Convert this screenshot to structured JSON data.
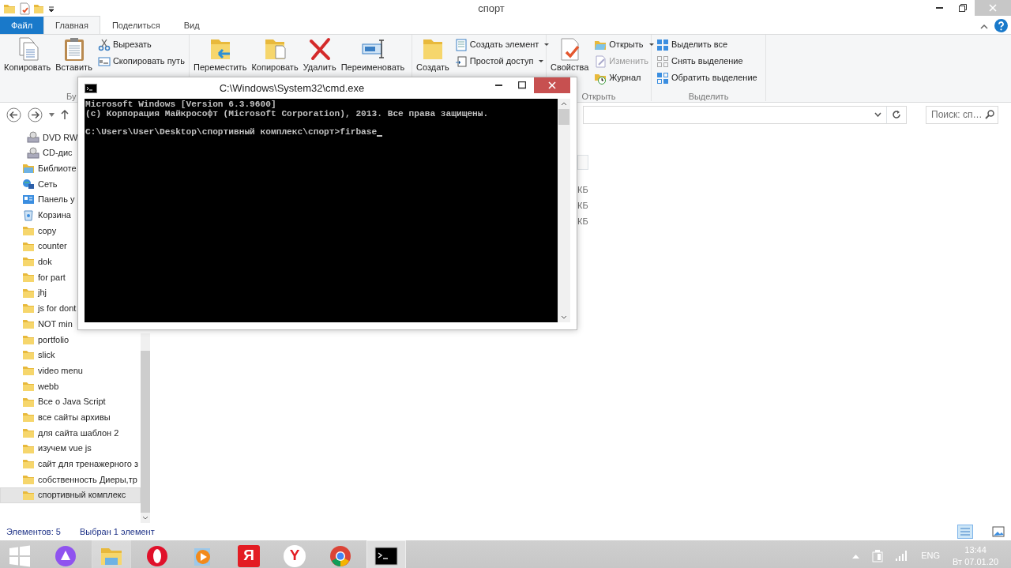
{
  "explorer": {
    "title": "спорт",
    "ribbon_tabs": [
      {
        "label": "Файл",
        "kind": "file",
        "selected": false
      },
      {
        "label": "Главная",
        "kind": "tab",
        "selected": true
      },
      {
        "label": "Поделиться",
        "kind": "tab",
        "selected": false
      },
      {
        "label": "Вид",
        "kind": "tab",
        "selected": false
      }
    ],
    "ribbon_groups": [
      {
        "label": "Бу",
        "large": [
          {
            "label": "Копировать"
          },
          {
            "label": "Вставить"
          }
        ],
        "small": [
          {
            "label": "Вырезать",
            "dropdown": false,
            "disabled": false
          },
          {
            "label": "Скопировать путь",
            "dropdown": false,
            "disabled": false
          }
        ]
      },
      {
        "large": [
          {
            "label": "Переместить"
          },
          {
            "label": "Копировать"
          },
          {
            "label": "Удалить"
          },
          {
            "label": "Переименовать"
          }
        ]
      },
      {
        "large": [
          {
            "label": "Создать"
          }
        ],
        "small": [
          {
            "label": "Создать элемент",
            "dropdown": true,
            "disabled": false
          },
          {
            "label": "Простой доступ",
            "dropdown": true,
            "disabled": false
          }
        ]
      },
      {
        "label": "Открыть",
        "large": [
          {
            "label": "Свойства"
          }
        ],
        "small": [
          {
            "label": "Открыть",
            "dropdown": true,
            "disabled": false
          },
          {
            "label": "Изменить",
            "dropdown": false,
            "disabled": true
          },
          {
            "label": "Журнал",
            "dropdown": false,
            "disabled": false
          }
        ]
      },
      {
        "label": "Выделить",
        "small": [
          {
            "label": "Выделить все",
            "dropdown": false,
            "disabled": false
          },
          {
            "label": "Снять выделение",
            "dropdown": false,
            "disabled": false
          },
          {
            "label": "Обратить выделение",
            "dropdown": false,
            "disabled": false
          }
        ]
      }
    ],
    "search": {
      "placeholder": "Поиск: сп…"
    },
    "sidebar": {
      "items": [
        {
          "label": "DVD RW",
          "kind": "drive",
          "selected": false
        },
        {
          "label": "CD-дис",
          "kind": "drive",
          "selected": false
        },
        {
          "label": "Библиоте",
          "kind": "library",
          "selected": false
        },
        {
          "label": "Сеть",
          "kind": "network",
          "selected": false
        },
        {
          "label": "Панель у",
          "kind": "control",
          "selected": false
        },
        {
          "label": "Корзина",
          "kind": "trash",
          "selected": false
        },
        {
          "label": "copy",
          "kind": "folder",
          "selected": false
        },
        {
          "label": "counter",
          "kind": "folder",
          "selected": false
        },
        {
          "label": "dok",
          "kind": "folder",
          "selected": false
        },
        {
          "label": "for part",
          "kind": "folder",
          "selected": false
        },
        {
          "label": "jhj",
          "kind": "folder",
          "selected": false
        },
        {
          "label": "js for dont",
          "kind": "folder",
          "selected": false
        },
        {
          "label": "NOT min",
          "kind": "folder",
          "selected": false
        },
        {
          "label": "portfolio",
          "kind": "folder",
          "selected": false
        },
        {
          "label": "slick",
          "kind": "folder",
          "selected": false
        },
        {
          "label": "video menu",
          "kind": "folder",
          "selected": false
        },
        {
          "label": "webb",
          "kind": "folder",
          "selected": false
        },
        {
          "label": "Все о Java Script",
          "kind": "folder",
          "selected": false
        },
        {
          "label": "все сайты архивы",
          "kind": "folder",
          "selected": false
        },
        {
          "label": "для сайта шаблон 2",
          "kind": "folder",
          "selected": false
        },
        {
          "label": "изучем vue js",
          "kind": "folder",
          "selected": false
        },
        {
          "label": "сайт для тренажерного з",
          "kind": "folder",
          "selected": false
        },
        {
          "label": "собственность Диеры,тр",
          "kind": "folder",
          "selected": false
        },
        {
          "label": "спортивный комплекс",
          "kind": "folder",
          "selected": true
        }
      ]
    },
    "file_sizes": [
      "КБ",
      "КБ",
      "КБ"
    ],
    "status_bar": {
      "count": "Элементов: 5",
      "selection": "Выбран 1 элемент"
    }
  },
  "console": {
    "title": "C:\\Windows\\System32\\cmd.exe",
    "output": [
      "Microsoft Windows [Version 6.3.9600]",
      "(c) Корпорация Майкрософт (Microsoft Corporation), 2013. Все права защищены."
    ],
    "prompt": "C:\\Users\\User\\Desktop\\спортивный комплекс\\спорт>firbase"
  },
  "taskbar": {
    "items": [
      {
        "kind": "start",
        "running": false,
        "selected": false
      },
      {
        "kind": "assistant",
        "running": false,
        "selected": false
      },
      {
        "kind": "explorer",
        "running": true,
        "selected": false
      },
      {
        "kind": "opera",
        "running": false,
        "selected": false
      },
      {
        "kind": "player",
        "running": false,
        "selected": false
      },
      {
        "kind": "yandex",
        "glyph": "Я",
        "running": false,
        "selected": false
      },
      {
        "kind": "ybrowser",
        "glyph": "Y",
        "running": false,
        "selected": false
      },
      {
        "kind": "chrome",
        "running": false,
        "selected": false
      },
      {
        "kind": "console",
        "running": true,
        "selected": true
      }
    ],
    "language": "ENG",
    "time": "13:44",
    "date": "Вт 07.01.20"
  }
}
